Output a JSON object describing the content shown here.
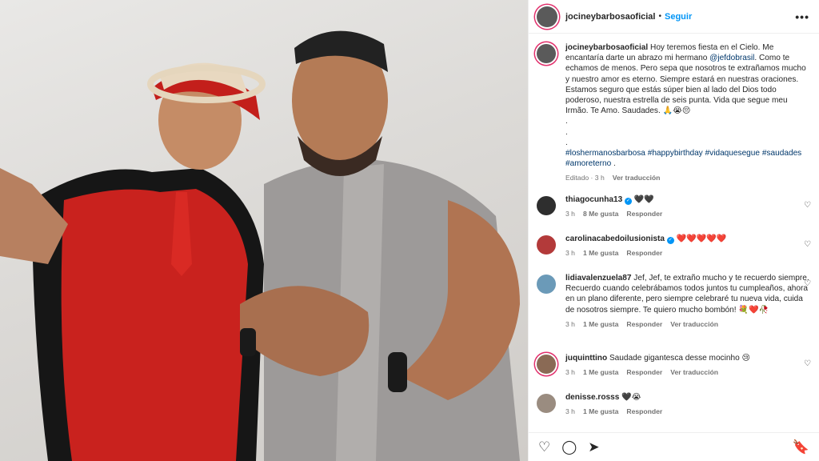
{
  "post": {
    "username": "jocineybarbosaoficial",
    "follow_label": "Seguir",
    "separator": "•",
    "more_label": "•••"
  },
  "caption": {
    "username": "jocineybarbosaoficial",
    "text_1": "Hoy teremos fiesta en el Cielo. Me encantaría darte un abrazo mi hermano",
    "mention": "@jefdobrasil",
    "text_2": ". Como te echamos de menos. Pero sepa que nosotros te extrañamos mucho y nuestro amor es eterno. Siempre estará en nuestras oraciones. Estamos seguro que estás súper bien al lado del Dios todo poderoso, nuestra estrella de seis punta. Vida que segue meu Irmão. Te Amo. Saudades. 🙏😭😔",
    "dots": [
      ".",
      ".",
      "."
    ],
    "hashtags": [
      "#loshermanosbarbosa",
      "#happybirthday",
      "#vidaquesegue",
      "#saudades",
      "#amoreterno"
    ],
    "trailing": ".",
    "edited": "Editado · 3 h",
    "translate": "Ver traducción"
  },
  "comments": [
    {
      "user": "thiagocunha13",
      "verified": true,
      "text": "🖤🖤",
      "time": "3 h",
      "likes": "8 Me gusta",
      "reply": "Responder"
    },
    {
      "user": "carolinacabedoilusionista",
      "verified": true,
      "text": "❤️❤️❤️❤️❤️",
      "time": "3 h",
      "likes": "1 Me gusta",
      "reply": "Responder"
    },
    {
      "user": "lidiavalenzuela87",
      "verified": false,
      "text": "Jef, Jef, te extraño mucho y te recuerdo siempre. Recuerdo cuando celebrábamos todos juntos tu cumpleaños, ahora en un plano diferente, pero siempre celebraré tu nueva vida, cuida de nosotros siempre. Te quiero mucho bombón! 💐❤️🥀",
      "time": "3 h",
      "likes": "1 Me gusta",
      "reply": "Responder",
      "translate": "Ver traducción"
    },
    {
      "user": "juquinttino",
      "verified": false,
      "text": "Saudade gigantesca desse mocinho 😢",
      "time": "3 h",
      "likes": "1 Me gusta",
      "reply": "Responder",
      "translate": "Ver traducción"
    },
    {
      "user": "denisse.rosss",
      "verified": false,
      "text": "🖤😭",
      "time": "3 h",
      "likes": "1 Me gusta",
      "reply": "Responder"
    }
  ],
  "icons": {
    "heart": "♡",
    "comment": "◯",
    "share": "➤",
    "bookmark": "🔖"
  }
}
